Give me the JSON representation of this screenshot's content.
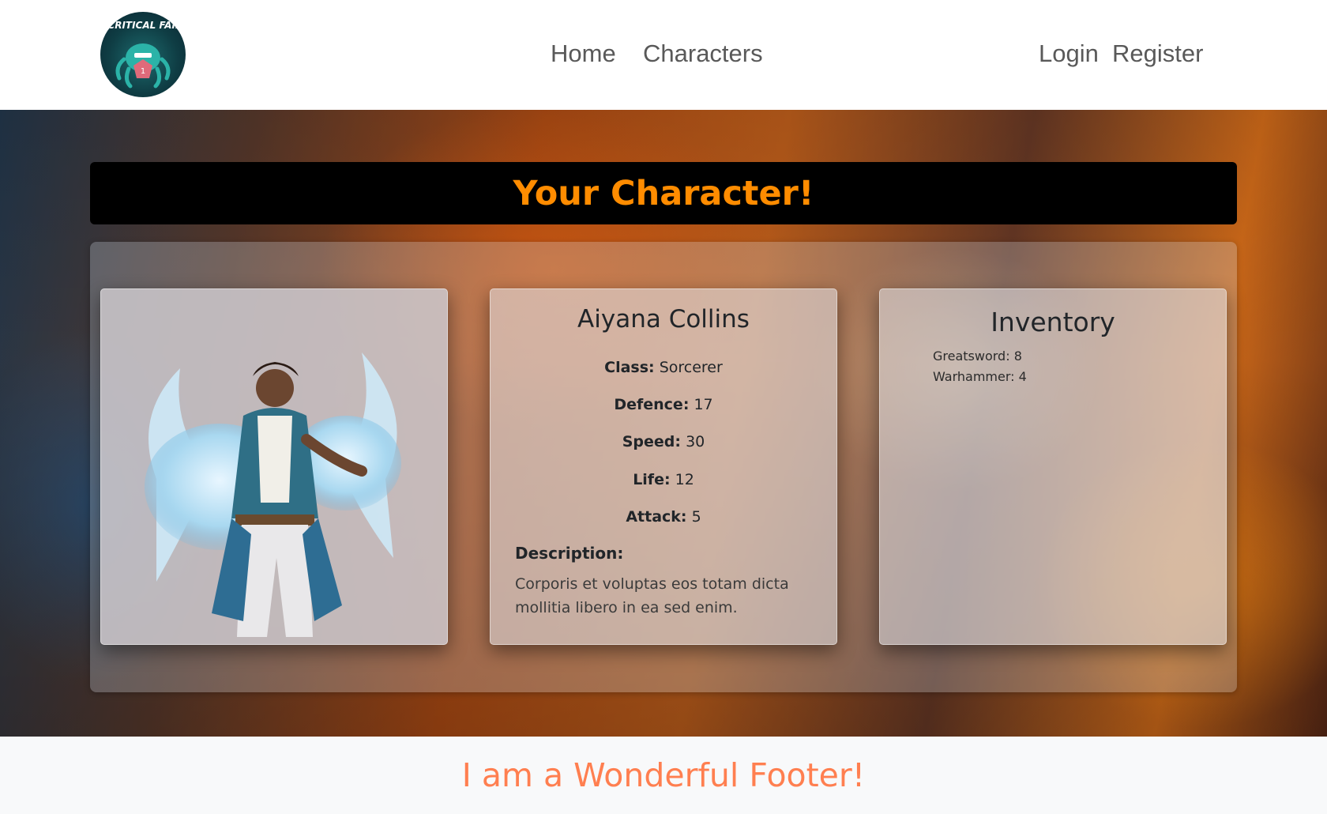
{
  "nav": {
    "logo_text": "CRITICAL FAIL",
    "home": "Home",
    "characters": "Characters",
    "login": "Login",
    "register": "Register"
  },
  "page_title": "Your Character!",
  "character": {
    "name": "Aiyana Collins",
    "stats": [
      {
        "label": "Class:",
        "value": "Sorcerer"
      },
      {
        "label": "Defence:",
        "value": "17"
      },
      {
        "label": "Speed:",
        "value": "30"
      },
      {
        "label": "Life:",
        "value": "12"
      },
      {
        "label": "Attack:",
        "value": "5"
      }
    ],
    "description_label": "Description:",
    "description": "Corporis et voluptas eos totam dicta mollitia libero in ea sed enim."
  },
  "inventory": {
    "title": "Inventory",
    "items": [
      "Greatsword: 8",
      "Warhammer: 4"
    ]
  },
  "footer": "I am a Wonderful Footer!",
  "colors": {
    "title_accent": "#ff8c00",
    "footer_accent": "#ff7f50"
  },
  "icons": {
    "logo": "tentacle-monster-d20-logo"
  }
}
